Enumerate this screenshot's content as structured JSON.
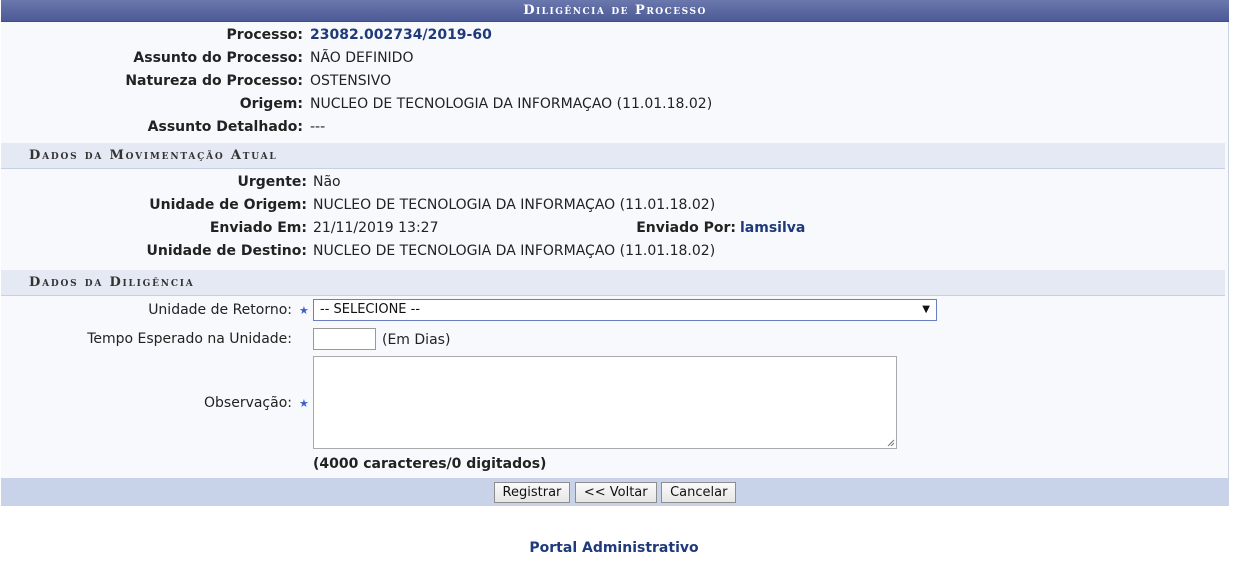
{
  "title": "Diligência de Processo",
  "process": {
    "processo_label": "Processo:",
    "processo_value": "23082.002734/2019-60",
    "assunto_label": "Assunto do Processo:",
    "assunto_value": "NÃO DEFINIDO",
    "natureza_label": "Natureza do Processo:",
    "natureza_value": "OSTENSIVO",
    "origem_label": "Origem:",
    "origem_value": "NUCLEO DE TECNOLOGIA DA INFORMAÇAO (11.01.18.02)",
    "assunto_det_label": "Assunto Detalhado:",
    "assunto_det_value": "---"
  },
  "movimentacao": {
    "section_title": "Dados da Movimentação Atual",
    "urgente_label": "Urgente:",
    "urgente_value": "Não",
    "unidade_origem_label": "Unidade de Origem:",
    "unidade_origem_value": "NUCLEO DE TECNOLOGIA DA INFORMAÇAO (11.01.18.02)",
    "enviado_em_label": "Enviado Em:",
    "enviado_em_value": "21/11/2019 13:27",
    "enviado_por_label": "Enviado Por:",
    "enviado_por_value": "lamsilva",
    "unidade_destino_label": "Unidade de Destino:",
    "unidade_destino_value": "NUCLEO DE TECNOLOGIA DA INFORMAÇAO (11.01.18.02)"
  },
  "diligencia": {
    "section_title": "Dados da Diligência",
    "retorno_label": "Unidade de Retorno:",
    "retorno_selected": "-- SELECIONE --",
    "tempo_label": "Tempo Esperado na Unidade:",
    "tempo_value": "",
    "tempo_unit": "(Em Dias)",
    "observacao_label": "Observação:",
    "observacao_value": "",
    "counter_text": "(4000 caracteres/0 digitados)"
  },
  "buttons": {
    "registrar": "Registrar",
    "voltar": "<< Voltar",
    "cancelar": "Cancelar"
  },
  "footer": {
    "portal_link": "Portal Administrativo"
  },
  "colors": {
    "title_bar": "#4c5a96",
    "section_bg": "#e4e9f4",
    "footer_bar": "#c8d3ea",
    "link": "#1f3a7a",
    "required_star": "#3b62c6"
  }
}
